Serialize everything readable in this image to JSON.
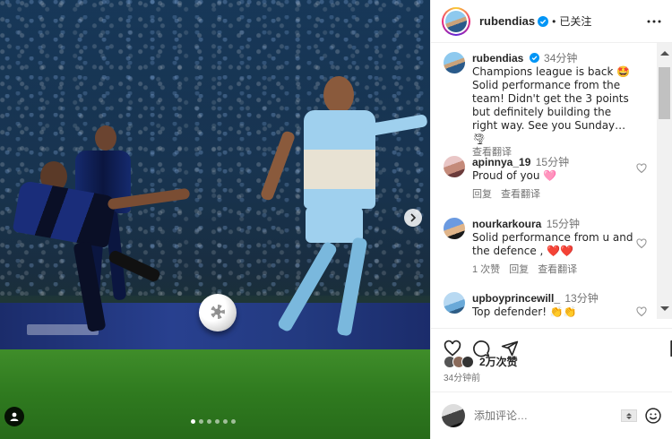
{
  "post": {
    "author": "rubendias",
    "follow_state": "已关注",
    "separator": "•",
    "caption": {
      "username": "rubendias",
      "time": "34分钟",
      "line1": "Champions league is back 🤩",
      "text": "Solid performance from the team! Didn't get the 3 points but definitely building the right way. See you Sunday… 🌪",
      "translate": "查看翻译"
    },
    "comments": [
      {
        "username": "apinnya_19",
        "time": "15分钟",
        "text": "Proud of you 🩷",
        "reply": "回复",
        "translate": "查看翻译"
      },
      {
        "username": "nourkarkoura",
        "time": "15分钟",
        "text": "Solid performance from u and the defence , ❤️❤️",
        "likes": "1 次赞",
        "reply": "回复",
        "translate": "查看翻译"
      },
      {
        "username": "upboyprincewill_",
        "time": "13分钟",
        "text": "Top defender! 👏👏"
      }
    ],
    "likes_count": "2万次赞",
    "posted_ago": "34分钟前",
    "composer_placeholder": "添加评论…"
  },
  "carousel": {
    "total_slides": 6,
    "active_index": 0
  },
  "icons": {
    "verified": "verified-badge-icon",
    "more": "more-options-icon",
    "heart": "heart-icon",
    "comment": "comment-icon",
    "share": "share-icon",
    "save": "save-icon",
    "emoji": "emoji-icon",
    "next": "chevron-right-icon",
    "tag": "user-tag-icon"
  },
  "colors": {
    "verified": "#0095f6",
    "text": "#262626",
    "muted": "#737373"
  }
}
